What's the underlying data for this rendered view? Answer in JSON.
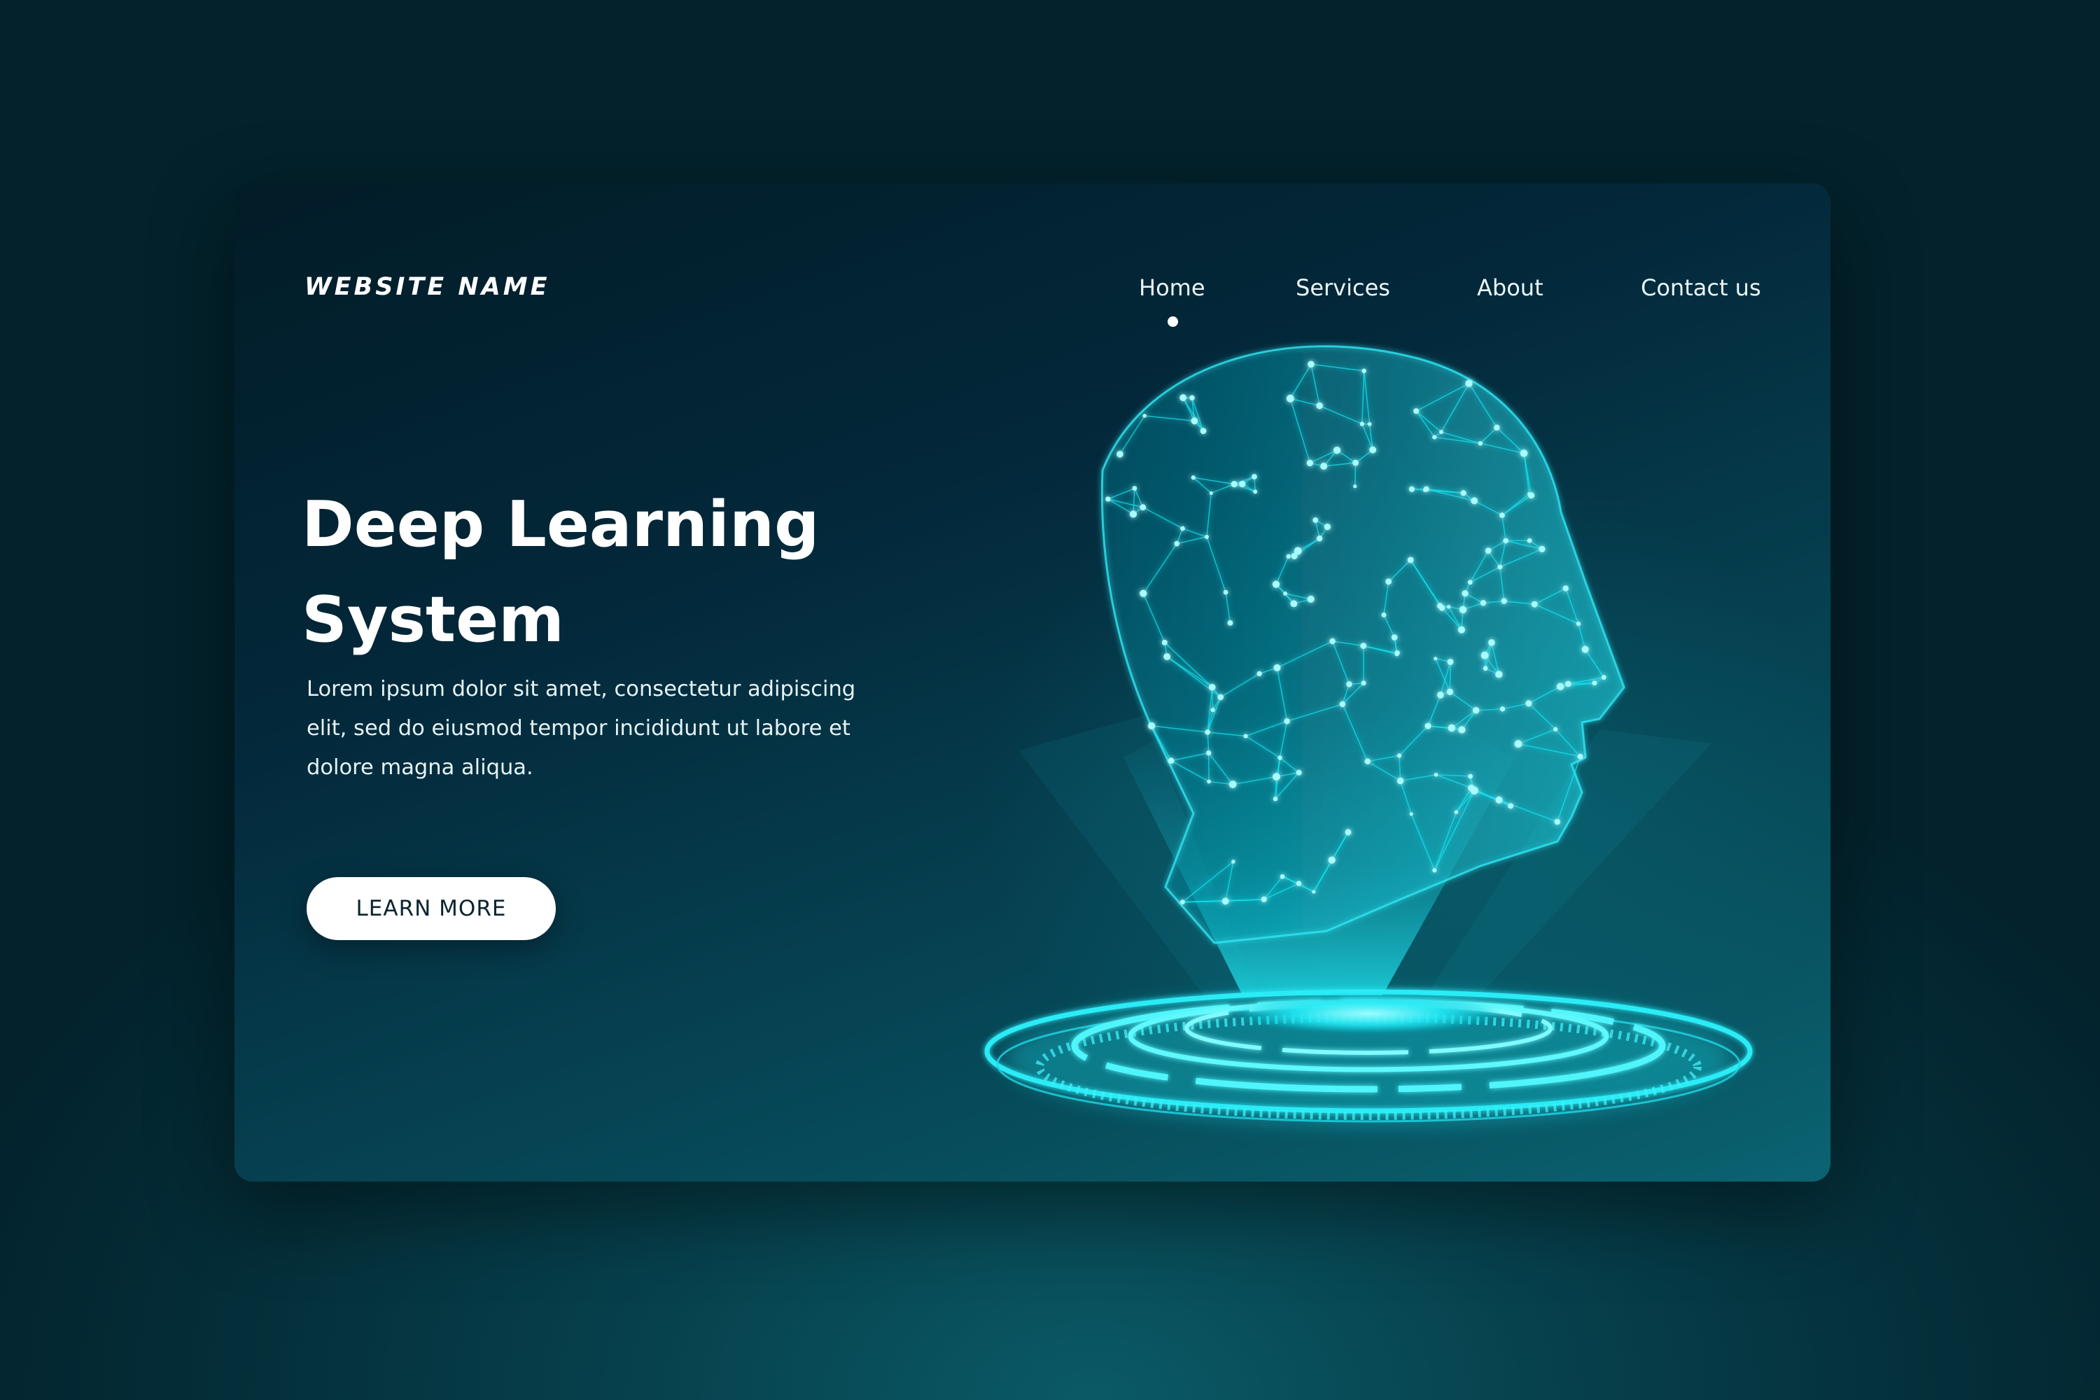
{
  "brand": {
    "name": "WEBSITE NAME"
  },
  "nav": {
    "items": [
      {
        "label": "Home",
        "active": true
      },
      {
        "label": "Services",
        "active": false
      },
      {
        "label": "About",
        "active": false
      },
      {
        "label": "Contact us",
        "active": false
      }
    ]
  },
  "hero": {
    "title_line1": "Deep Learning",
    "title_line2": "System",
    "body_line1": "Lorem ipsum dolor sit amet, consectetur adipiscing",
    "body_line2": "elit, sed do eiusmod tempor incididunt ut labore et",
    "body_line3": "dolore magna aliqua.",
    "cta_label": "LEARN MORE"
  },
  "illustration": {
    "subject": "polygonal-head-hologram-icon",
    "accent": "#19e6f2",
    "glow": "#0fd2e0"
  },
  "colors": {
    "background": "#042d38",
    "card": "#03283a",
    "text": "#ffffff",
    "button": "#ffffff"
  }
}
